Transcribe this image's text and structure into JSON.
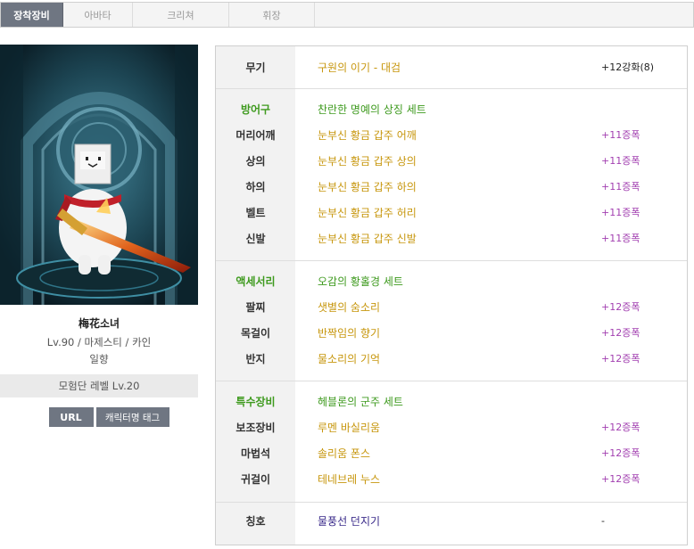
{
  "tabs": [
    {
      "label": "장착장비",
      "active": true
    },
    {
      "label": "아바타",
      "active": false
    },
    {
      "label": "크리쳐",
      "active": false
    },
    {
      "label": "휘장",
      "active": false
    }
  ],
  "character": {
    "name": "梅花소녀",
    "info": "Lv.90 / 마제스티 / 카인",
    "guild": "일향",
    "party_level": "모험단 레벨 Lv.20",
    "buttons": {
      "url": "URL",
      "tag": "캐릭터명 태그"
    }
  },
  "equipment": {
    "weapon": {
      "slot": "무기",
      "name": "구원의 이기 - 대검",
      "enhance": "+12강화(8)"
    },
    "armor": {
      "group": "방어구",
      "set": "찬란한 명예의 상징 세트",
      "items": [
        {
          "slot": "머리어깨",
          "name": "눈부신 황금 갑주 어깨",
          "enhance": "+11증폭"
        },
        {
          "slot": "상의",
          "name": "눈부신 황금 갑주 상의",
          "enhance": "+11증폭"
        },
        {
          "slot": "하의",
          "name": "눈부신 황금 갑주 하의",
          "enhance": "+11증폭"
        },
        {
          "slot": "벨트",
          "name": "눈부신 황금 갑주 허리",
          "enhance": "+11증폭"
        },
        {
          "slot": "신발",
          "name": "눈부신 황금 갑주 신발",
          "enhance": "+11증폭"
        }
      ]
    },
    "accessory": {
      "group": "액세서리",
      "set": "오감의 황홀경 세트",
      "items": [
        {
          "slot": "팔찌",
          "name": "샛별의 숨소리",
          "enhance": "+12증폭"
        },
        {
          "slot": "목걸이",
          "name": "반짝임의 향기",
          "enhance": "+12증폭"
        },
        {
          "slot": "반지",
          "name": "물소리의 기억",
          "enhance": "+12증폭"
        }
      ]
    },
    "special": {
      "group": "특수장비",
      "set": "헤블론의 군주 세트",
      "items": [
        {
          "slot": "보조장비",
          "name": "루멘 바실리움",
          "enhance": "+12증폭"
        },
        {
          "slot": "마법석",
          "name": "솔리움 폰스",
          "enhance": "+12증폭"
        },
        {
          "slot": "귀걸이",
          "name": "테네브레 누스",
          "enhance": "+12증폭"
        }
      ]
    },
    "title": {
      "slot": "칭호",
      "name": "물풍선 던지기",
      "enhance": "-"
    }
  },
  "colors": {
    "tab_active": "#6f7682",
    "item_gold": "#c7960c",
    "set_green": "#3e9a1e",
    "amplify_purple": "#a23fb0",
    "title_navy": "#3a2a8a"
  }
}
